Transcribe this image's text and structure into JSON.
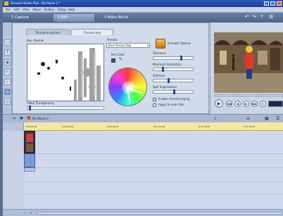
{
  "window": {
    "title": "Pinnacle Studio Plus - My Movie 2 *",
    "menu": [
      "File",
      "Edit",
      "View",
      "Album",
      "Toolbox",
      "Setup",
      "Help"
    ]
  },
  "modes": [
    {
      "label": "1 Capture"
    },
    {
      "label": "2 Edit"
    },
    {
      "label": "3 Make Movie"
    }
  ],
  "editor": {
    "tabs": [
      "Picture-in-picture",
      "Chroma key"
    ],
    "key_channel_label": "Key channel",
    "video_transparency_label": "Video Transparency",
    "presets_label": "Presets",
    "preset_value": "Blue Screen Key",
    "key_color_label": "Key Color",
    "activate_label": "Activate Options",
    "tolerance_label": "Tolerance",
    "min_saturation_label": "Minimum Saturation",
    "softness_label": "Softness",
    "spill_label": "Spill Suppression",
    "enable_chroma_label": "Enable chroma keying",
    "apply_new_label": "Apply to new clips",
    "key_color_hex": "#2b4fa8"
  },
  "timeline": {
    "tab_label": "My Movie 2",
    "ruler": [
      "0:00:00.00",
      "0:00:24.00",
      "0:00:48.00",
      "0:01:12.00",
      "0:01:36.00",
      "0:02:00.00"
    ]
  }
}
